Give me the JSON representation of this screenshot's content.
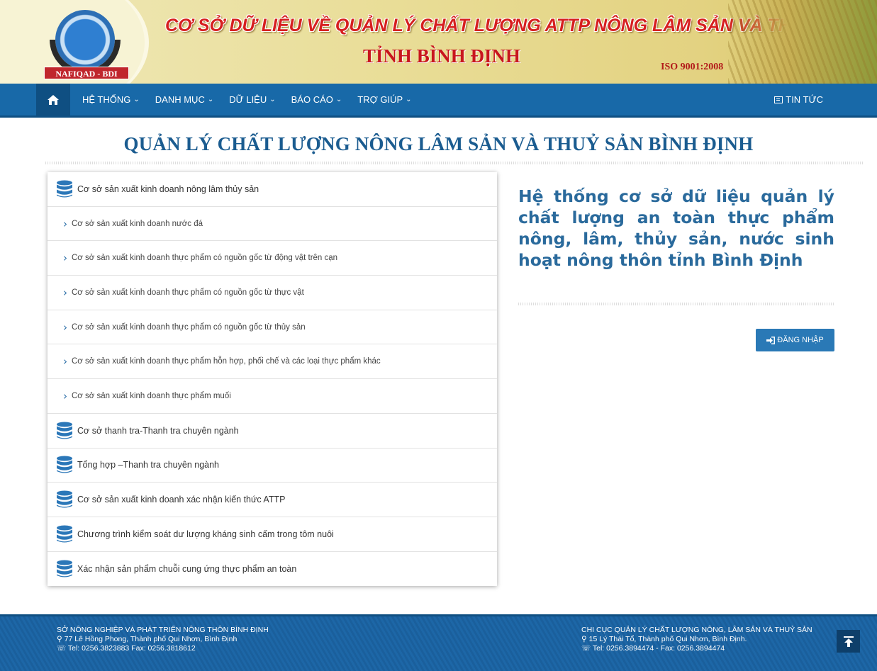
{
  "banner": {
    "logo_text": "NAFIQAD - BDI",
    "title": "CƠ SỞ DỮ LIỆU VỀ QUẢN LÝ CHẤT LƯỢNG ATTP NÔNG LÂM SẢN VÀ THỦY SẢN",
    "subtitle": "TỈNH BÌNH ĐỊNH",
    "iso": "ISO 9001:2008"
  },
  "nav": {
    "items": [
      {
        "label": "HỆ THỐNG"
      },
      {
        "label": "DANH MỤC"
      },
      {
        "label": "DỮ LIỆU"
      },
      {
        "label": "BÁO CÁO"
      },
      {
        "label": "TRỢ GIÚP"
      }
    ],
    "news": "TIN TỨC",
    "colors": {
      "bar": "#1869a8",
      "home": "#0f4f82"
    }
  },
  "page_title": "QUẢN LÝ CHẤT LƯỢNG NÔNG LÂM SẢN VÀ THUỶ SẢN BÌNH ĐỊNH",
  "list": [
    {
      "label": "Cơ sở sản xuất kinh doanh nông lâm thủy sản",
      "kind": "main"
    },
    {
      "label": "Cơ sở sản xuất kinh doanh nước đá",
      "kind": "sub"
    },
    {
      "label": "Cơ sở sản xuất kinh doanh thực phẩm có nguồn gốc từ động vật trên cạn",
      "kind": "sub"
    },
    {
      "label": "Cơ sở sản xuất kinh doanh thực phẩm có nguồn gốc từ thực vật",
      "kind": "sub"
    },
    {
      "label": "Cơ sở sản xuất kinh doanh thực phẩm có nguồn gốc từ thủy sản",
      "kind": "sub"
    },
    {
      "label": "Cơ sở sản xuất kinh doanh thực phẩm hỗn hợp, phối chế và các loại thực phẩm khác",
      "kind": "sub"
    },
    {
      "label": "Cơ sở sản xuất kinh doanh thực phẩm muối",
      "kind": "sub"
    },
    {
      "label": "Cơ sở thanh tra-Thanh tra chuyên ngành",
      "kind": "main"
    },
    {
      "label": "Tổng hợp –Thanh tra chuyên ngành",
      "kind": "main"
    },
    {
      "label": "Cơ sở sản xuất kinh doanh xác nhận kiến thức ATTP",
      "kind": "main"
    },
    {
      "label": "Chương trình kiểm soát dư lượng kháng sinh cấm trong tôm nuôi",
      "kind": "main"
    },
    {
      "label": "Xác nhận sản phẩm chuỗi cung ứng thực phẩm an toàn",
      "kind": "main"
    }
  ],
  "description": "Hệ thống cơ sở dữ liệu quản lý chất lượng an toàn thực phẩm nông, lâm, thủy sản, nước sinh hoạt nông thôn tỉnh Bình Định",
  "login_label": "ĐĂNG NHẬP",
  "footer": {
    "left": {
      "org": "SỞ NÔNG NGHIỆP VÀ PHÁT TRIỂN NÔNG THÔN BÌNH ĐỊNH",
      "address": "77 Lê Hồng Phong, Thành phố Qui Nhơn, Bình Định",
      "phone": "Tel: 0256.3823883 Fax: 0256.3818612"
    },
    "right": {
      "org": "CHI CỤC QUẢN LÝ CHẤT LƯỢNG NÔNG, LÂM SẢN VÀ THUỶ SẢN",
      "address": "15 Lý Thái Tổ, Thành phố Qui Nhơn, Bình Định.",
      "phone": "Tel: 0256.3894474 - Fax: 0256.3894474"
    }
  },
  "icons": {
    "home": "home-icon",
    "database": "database-icon",
    "chevron": "chevron-right-icon",
    "login": "sign-in-icon",
    "news": "newspaper-icon",
    "to_top": "arrow-up-icon",
    "map": "map-marker-icon",
    "phone": "phone-icon"
  }
}
